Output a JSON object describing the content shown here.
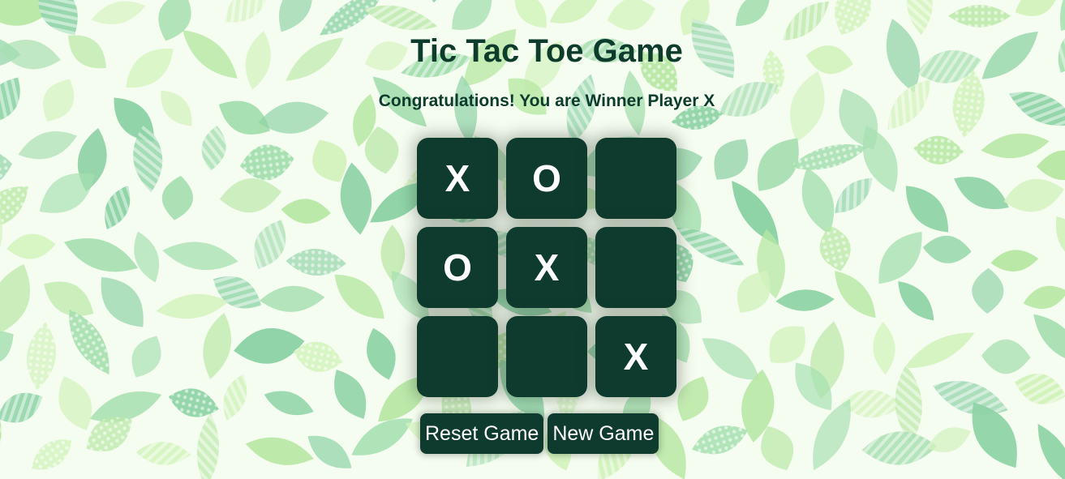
{
  "game": {
    "title": "Tic Tac Toe Game",
    "message": "Congratulations! You are Winner Player X",
    "board": [
      "X",
      "O",
      "",
      "O",
      "X",
      "",
      "",
      "",
      "X"
    ]
  },
  "controls": {
    "reset_label": "Reset Game",
    "new_label": "New Game"
  },
  "theme": {
    "primary": "#0e3b2e",
    "text": "#0d3b2c",
    "leaf_colors": [
      "#8ed3a6",
      "#b8e8a5",
      "#d3f3bd",
      "#a6dfb0"
    ],
    "background_pattern": "leaf-pattern"
  }
}
